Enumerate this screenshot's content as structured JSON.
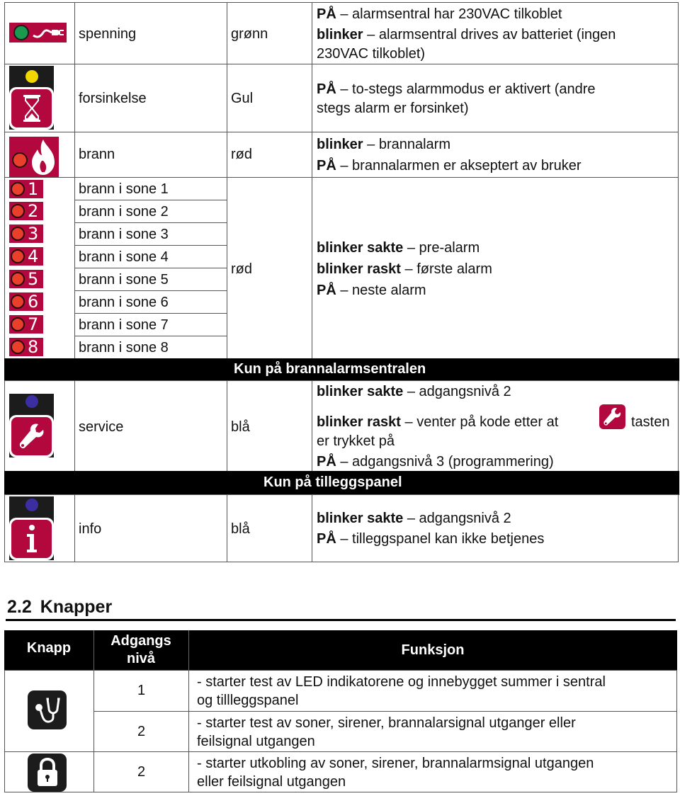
{
  "led_table": {
    "rows": [
      {
        "icon": "power-plug-icon",
        "led_color_hex": "#1a9a4e",
        "name": "spenning",
        "color": "grønn",
        "lines": [
          {
            "bold": "PÅ",
            "text": " – alarmsentral har 230VAC tilkoblet"
          },
          {
            "bold": "blinker",
            "text": " – alarmsentral drives av batteriet (ingen"
          },
          {
            "bold": "",
            "text": "230VAC tilkoblet)"
          }
        ]
      },
      {
        "icon": "hourglass-icon",
        "led_color_hex": "#f2d600",
        "name": "forsinkelse",
        "color": "Gul",
        "lines": [
          {
            "bold": "PÅ",
            "text": " – to-stegs alarmmodus er aktivert (andre"
          },
          {
            "bold": "",
            "text": "stegs alarm er forsinket)"
          }
        ]
      },
      {
        "icon": "fire-icon",
        "led_color_hex": "#e8402a",
        "name": "brann",
        "color": "rød",
        "lines": [
          {
            "bold": "blinker",
            "text": " – brannalarm"
          },
          {
            "bold": "PÅ",
            "text": " – brannalarmen er akseptert av bruker"
          }
        ]
      }
    ],
    "zones": {
      "items": [
        {
          "number": "1",
          "name": "brann i sone 1"
        },
        {
          "number": "2",
          "name": "brann i sone 2"
        },
        {
          "number": "3",
          "name": "brann i sone 3"
        },
        {
          "number": "4",
          "name": "brann i sone 4"
        },
        {
          "number": "5",
          "name": "brann i sone 5"
        },
        {
          "number": "6",
          "name": "brann i sone 6"
        },
        {
          "number": "7",
          "name": "brann i sone 7"
        },
        {
          "number": "8",
          "name": "brann i sone 8"
        }
      ],
      "color": "rød",
      "lines": [
        {
          "bold": "blinker sakte",
          "text": " – pre-alarm"
        },
        {
          "bold": "blinker raskt",
          "text": " – første alarm"
        },
        {
          "bold": "PÅ",
          "text": " – neste alarm"
        }
      ]
    },
    "band_central": "Kun på brannalarmsentralen",
    "service": {
      "icon": "wrench-icon",
      "led_color_hex": "#3b2ea0",
      "name": "service",
      "color": "blå",
      "line1": {
        "bold": "blinker sakte",
        "text": " – adgangsnivå 2"
      },
      "line2": {
        "bold": "blinker raskt",
        "text": " – venter på kode etter at",
        "after_icon": "tasten"
      },
      "line3": {
        "text": "er trykket på"
      },
      "line4": {
        "bold": "PÅ",
        "text": " – adgangsnivå 3 (programmering)"
      }
    },
    "band_panel": "Kun på tilleggspanel",
    "info": {
      "icon": "info-icon",
      "led_color_hex": "#3b2ea0",
      "name": "info",
      "color": "blå",
      "lines": [
        {
          "bold": "blinker sakte",
          "text": " – adgangsnivå 2"
        },
        {
          "bold": "PÅ",
          "text": " – tilleggspanel kan ikke betjenes"
        }
      ]
    }
  },
  "section": {
    "number": "2.2",
    "title": "Knapper"
  },
  "buttons_table": {
    "headers": {
      "button": "Knapp",
      "level_line1": "Adgangs",
      "level_line2": "nivå",
      "function": "Funksjon"
    },
    "rows": [
      {
        "icon": "stethoscope-icon",
        "level": "1",
        "function_line1": "- starter test av LED indikatorene og innebygget summer i sentral",
        "function_line2": "og tillleggspanel"
      },
      {
        "icon": "stethoscope-icon",
        "level": "2",
        "function_line1": "- starter test av soner, sirener, brannalarsignal utganger eller",
        "function_line2": "feilsignal utgangen"
      },
      {
        "icon": "padlock-icon",
        "level": "2",
        "function_line1": "- starter utkobling av soner, sirener, brannalarmsignal utgangen",
        "function_line2": "eller feilsignal utgangen"
      }
    ]
  },
  "colors": {
    "icon_maroon": "#b2083e",
    "band_black": "#000000",
    "zone_led_red": "#e8402a"
  }
}
